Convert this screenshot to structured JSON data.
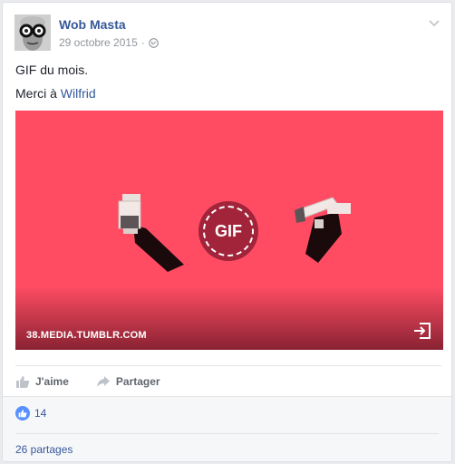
{
  "post": {
    "author": "Wob Masta",
    "date": "29 octobre 2015",
    "date_separator": "·",
    "text_line1": "GIF du mois.",
    "text_line2_prefix": "Merci à ",
    "text_line2_link": "Wilfrid"
  },
  "media": {
    "badge": "GIF",
    "domain": "38.MEDIA.TUMBLR.COM",
    "background": "#ff4c63"
  },
  "actions": {
    "like": "J'aime",
    "share": "Partager"
  },
  "footer": {
    "like_count": "14",
    "shares": "26 partages"
  },
  "icons": [
    "globe-icon",
    "chevron-down-icon",
    "exit-icon",
    "thumbs-up-icon",
    "share-arrow-icon",
    "like-bubble-icon"
  ],
  "colors": {
    "link": "#365899",
    "meta": "#90949c",
    "like_blue": "#5890ff"
  }
}
